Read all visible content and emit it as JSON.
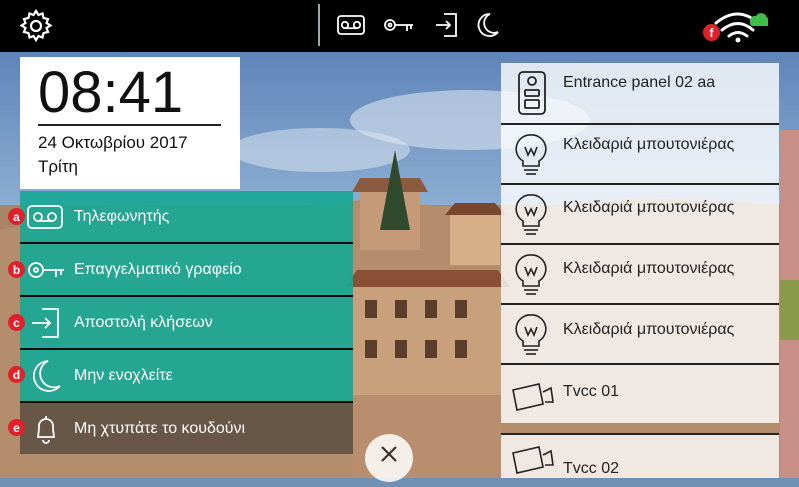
{
  "clock": {
    "time": "08:41",
    "date": "24 Οκτωβρίου 2017",
    "weekday": "Τρίτη"
  },
  "topbar": {
    "icons": [
      "gear-icon",
      "answering-machine-icon",
      "key-icon",
      "call-forward-icon",
      "moon-icon",
      "wifi-cloud-icon"
    ],
    "wifi_badge": "f"
  },
  "menu": [
    {
      "badge": "a",
      "label": "Τηλεφωνητής",
      "icon": "answering-machine-icon"
    },
    {
      "badge": "b",
      "label": "Επαγγελματικό γραφείο",
      "icon": "key-icon"
    },
    {
      "badge": "c",
      "label": "Αποστολή κλήσεων",
      "icon": "call-forward-icon"
    },
    {
      "badge": "d",
      "label": "Μην ενοχλείτε",
      "icon": "moon-icon"
    },
    {
      "badge": "e",
      "label": "Μη χτυπάτε το κουδούνι",
      "icon": "bell-off-icon"
    }
  ],
  "right_list": [
    {
      "label": "Entrance panel 02 aa",
      "icon": "entrance-panel-icon"
    },
    {
      "label": "Κλειδαριά μπουτονιέρας",
      "icon": "lightbulb-icon"
    },
    {
      "label": "Κλειδαριά μπουτονιέρας",
      "icon": "lightbulb-icon"
    },
    {
      "label": "Κλειδαριά μπουτονιέρας",
      "icon": "lightbulb-icon"
    },
    {
      "label": "Κλειδαριά μπουτονιέρας",
      "icon": "lightbulb-icon"
    },
    {
      "label": "Tvcc 01",
      "icon": "cctv-camera-icon"
    },
    {
      "label": "Tvcc 02",
      "icon": "cctv-camera-icon"
    }
  ],
  "colors": {
    "teal": "#1aa896",
    "badge_red": "#e0202a",
    "cloud_green": "#3fbf4a"
  }
}
